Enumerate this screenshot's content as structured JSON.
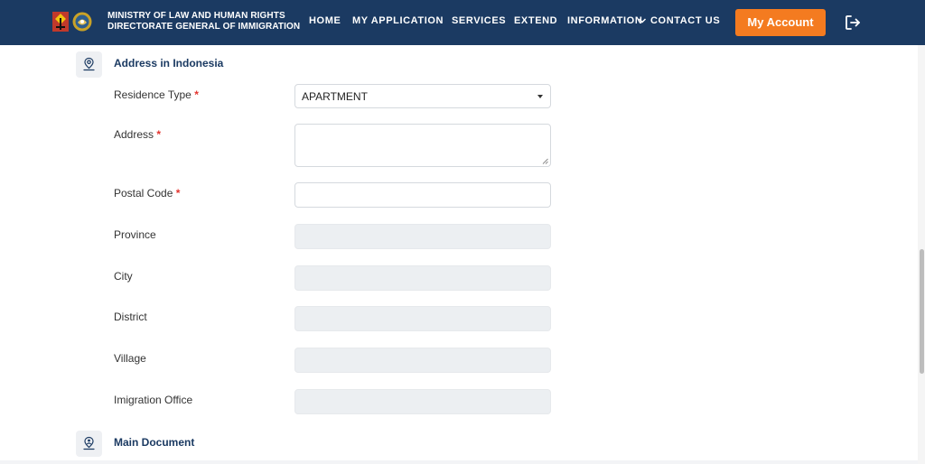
{
  "header": {
    "ministry_line1": "MINISTRY OF  LAW  AND HUMAN RIGHTS",
    "ministry_line2": "DIRECTORATE GENERAL OF IMMIGRATION",
    "nav": {
      "home": "HOME",
      "my_application": "MY APPLICATION",
      "services": "SERVICES",
      "extend": "EXTEND",
      "information": "INFORMATION",
      "contact_us": "CONTACT US"
    },
    "account_button": "My Account",
    "colors": {
      "bar": "#1b3a62",
      "accent": "#f47b20"
    }
  },
  "sections": {
    "address": {
      "title": "Address in Indonesia",
      "icon": "location-pin-icon"
    },
    "main_document": {
      "title": "Main Document",
      "icon": "user-pin-icon"
    }
  },
  "form": {
    "required_mark": "*",
    "residence_type": {
      "label": "Residence Type",
      "value": "APARTMENT"
    },
    "address": {
      "label": "Address",
      "value": ""
    },
    "postal_code": {
      "label": "Postal Code",
      "value": ""
    },
    "province": {
      "label": "Province",
      "value": ""
    },
    "city": {
      "label": "City",
      "value": ""
    },
    "district": {
      "label": "District",
      "value": ""
    },
    "village": {
      "label": "Village",
      "value": ""
    },
    "immigration_office": {
      "label": "Imigration Office",
      "value": ""
    }
  }
}
